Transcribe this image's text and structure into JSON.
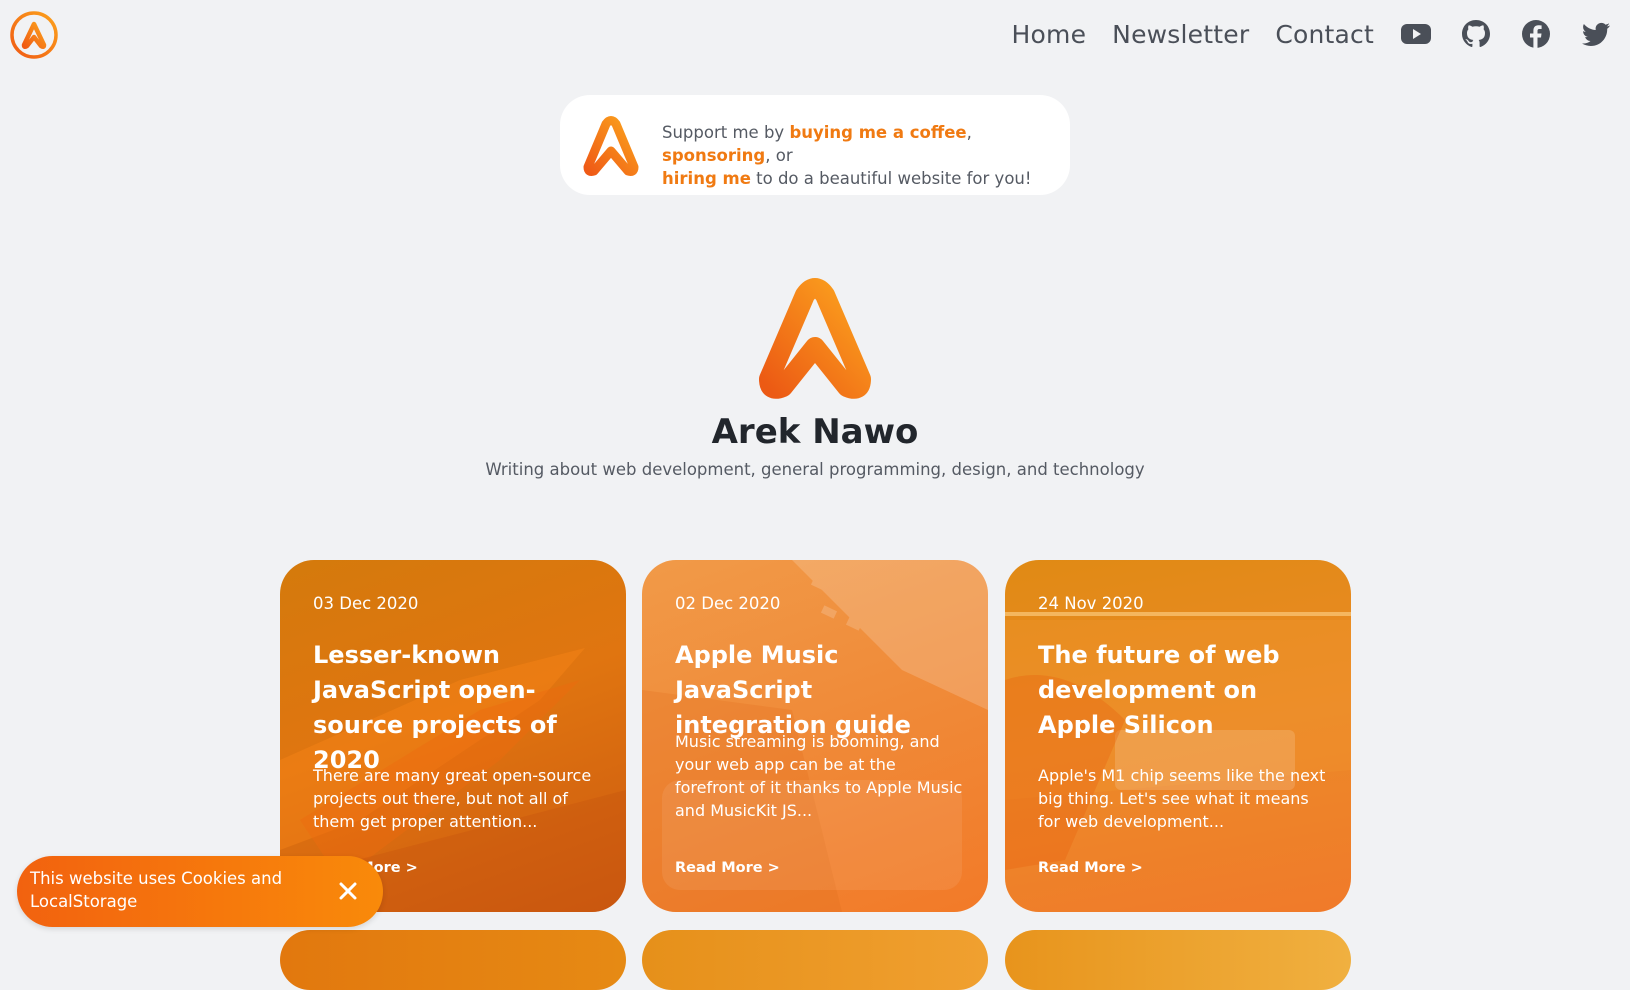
{
  "header": {
    "nav": [
      {
        "label": "Home"
      },
      {
        "label": "Newsletter"
      },
      {
        "label": "Contact"
      }
    ],
    "social_icons": [
      "youtube-icon",
      "github-icon",
      "facebook-icon",
      "twitter-icon"
    ]
  },
  "support": {
    "text_prefix": "Support me by ",
    "link_coffee": "buying me a coffee",
    "comma": ", ",
    "link_sponsor": "sponsoring",
    "or": ", or",
    "link_hire": "hiring me",
    "text_suffix": " to do a beautiful website for you!"
  },
  "profile": {
    "name": "Arek Nawo",
    "description": "Writing about web development, general programming, design, and technology"
  },
  "posts": [
    {
      "date": "03 Dec 2020",
      "title": "Lesser-known JavaScript open-source projects of 2020",
      "excerpt": "There are many great open-source projects out there, but not all of them get proper attention...",
      "read_more": "Read More >"
    },
    {
      "date": "02 Dec 2020",
      "title": "Apple Music JavaScript integration guide",
      "excerpt": "Music streaming is booming, and your web app can be at the forefront of it thanks to Apple Music and MusicKit JS...",
      "read_more": "Read More >"
    },
    {
      "date": "24 Nov 2020",
      "title": "The future of web development on Apple Silicon",
      "excerpt": "Apple's M1 chip seems like the next big thing. Let's see what it means for web development...",
      "read_more": "Read More >"
    }
  ],
  "cookie": {
    "text": "This website uses Cookies and LocalStorage"
  },
  "colors": {
    "accent": "#f07a12",
    "background": "#f1f2f4",
    "nav_text": "#4a4f58"
  }
}
